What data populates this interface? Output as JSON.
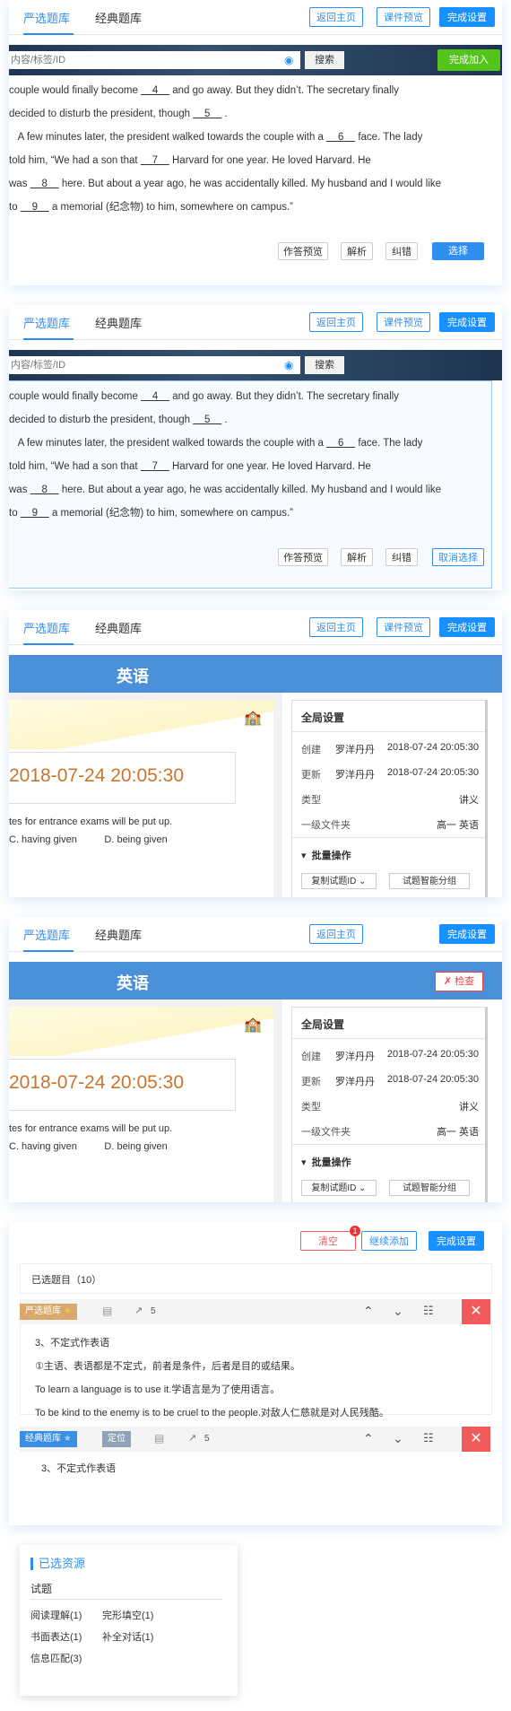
{
  "tabs": {
    "strict": "严选题库",
    "classic": "经典题库"
  },
  "buttons": {
    "home": "返回主页",
    "preview": "课件预览",
    "finish": "完成设置",
    "clear": "清空",
    "continue_add": "继续添加",
    "finish_join": "完成加入",
    "check": "检查"
  },
  "search": {
    "placeholder": "内容/标签/ID",
    "button": "搜索"
  },
  "passage": {
    "line1_a": "couple would finally become",
    "blank4": "4",
    "line1_b": "and go away. But they didn’t. The secretary finally",
    "line2_a": "decided to disturb the president, though",
    "blank5": "5",
    "line2_b": ".",
    "line3_a": "A few minutes later, the president walked towards the couple with a",
    "blank6": "6",
    "line3_b": "face. The lady",
    "line4_a": "told him,  “We had a son that",
    "blank7": "7",
    "line4_b": "Harvard for one year. He loved Harvard. He",
    "line5_a": "was",
    "blank8": "8",
    "line5_b": "here. But about a year ago, he was accidentally killed. My husband and I would like",
    "line6_a": "to",
    "blank9": "9",
    "line6_b": "a memorial (纪念物) to him, somewhere on campus.”"
  },
  "actions": {
    "answer_preview": "作答预览",
    "analysis": "解析",
    "correct": "纠错",
    "select": "选择",
    "cancel_select": "取消选择"
  },
  "course": {
    "subject": "英语",
    "date": "2018-07-24 20:05:30",
    "doc_line1": "tes for entrance exams will be put up.",
    "doc_opt_c": "C.  having given",
    "doc_opt_d": "D.  being given"
  },
  "settings": {
    "title": "全局设置",
    "created_label": "创建",
    "created_by": "罗洋丹丹",
    "created_at": "2018-07-24 20:05:30",
    "updated_label": "更新",
    "updated_by": "罗洋丹丹",
    "updated_at": "2018-07-24 20:05:30",
    "type_label": "类型",
    "type_value": "讲义",
    "folder_label": "一级文件夹",
    "folder_value": "高一 英语",
    "batch_title": "批量操作",
    "copy_id": "复制试题ID",
    "smart_group": "试题智能分组"
  },
  "selected": {
    "header": "已选题目（10）",
    "badge_count": "1",
    "q1_tag": "严选题库",
    "q1_count": "5",
    "q1_title": "3、不定式作表语",
    "q1_line1": "①主语、表语都是不定式，前者是条件，后者是目的或结果。",
    "q1_line2": "To learn a language is to use it.学语言是为了使用语言。",
    "q1_line3": "To be kind to the enemy is to be cruel to the people.对敌人仁慈就是对人民残酷。",
    "q2_tag": "经典题库",
    "q2_locate": "定位",
    "q2_count": "5",
    "q2_title": "3、不定式作表语"
  },
  "resource": {
    "title": "已选资源",
    "category": "试题",
    "items": [
      "阅读理解(1)",
      "完形填空(1)",
      "书面表达(1)",
      "补全对话(1)",
      "信息匹配(3)"
    ]
  }
}
